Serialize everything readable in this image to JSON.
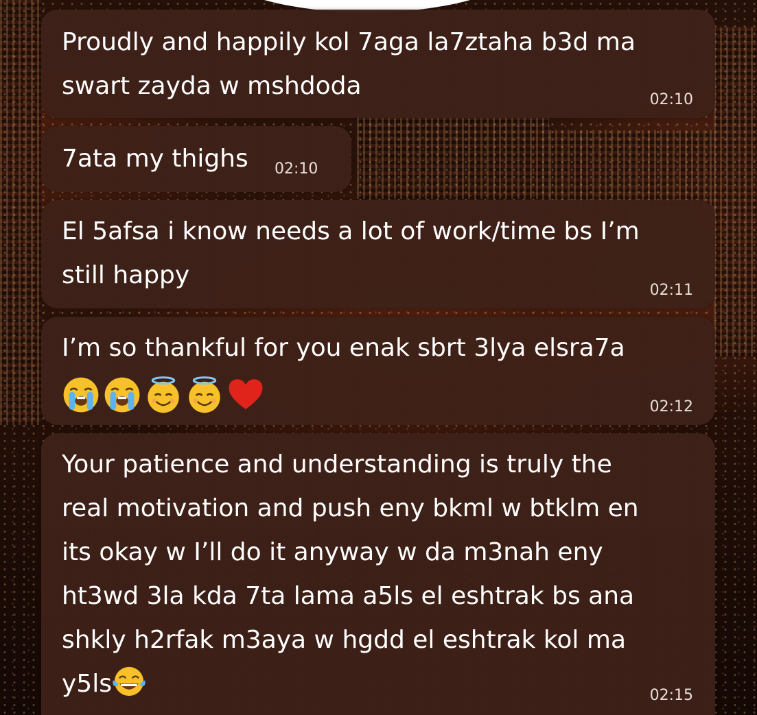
{
  "messages": [
    {
      "lines": [
        "Proudly and happily kol 7aga la7ztaha b3d ma",
        "swart zayda w mshdoda"
      ],
      "time": "02:10"
    },
    {
      "lines": [
        "7ata my thighs"
      ],
      "time": "02:10"
    },
    {
      "lines": [
        "El 5afsa i know needs a lot of work/time bs I’m",
        "still happy"
      ],
      "time": "02:11"
    },
    {
      "lines": [
        "I’m so thankful for you enak sbrt 3lya elsra7a"
      ],
      "emojis": [
        "loudly-crying-face",
        "loudly-crying-face",
        "smiling-face-with-halo",
        "smiling-face-with-halo",
        "red-heart"
      ],
      "time": "02:12"
    },
    {
      "lines": [
        "Your patience and understanding is truly the",
        "real motivation and push eny bkml w btklm en",
        "its okay w I’ll do it anyway w da m3nah eny",
        "ht3wd 3la kda 7ta lama a5ls el eshtrak bs ana",
        "shkly h2rfak m3aya w hgdd el eshtrak kol ma",
        "y5ls"
      ],
      "trailing_emoji": "face-with-tears-of-joy",
      "time": "02:15"
    }
  ],
  "colors": {
    "bubble": "#3e2118",
    "text": "#ffffff",
    "time": "#e9e0dc"
  }
}
